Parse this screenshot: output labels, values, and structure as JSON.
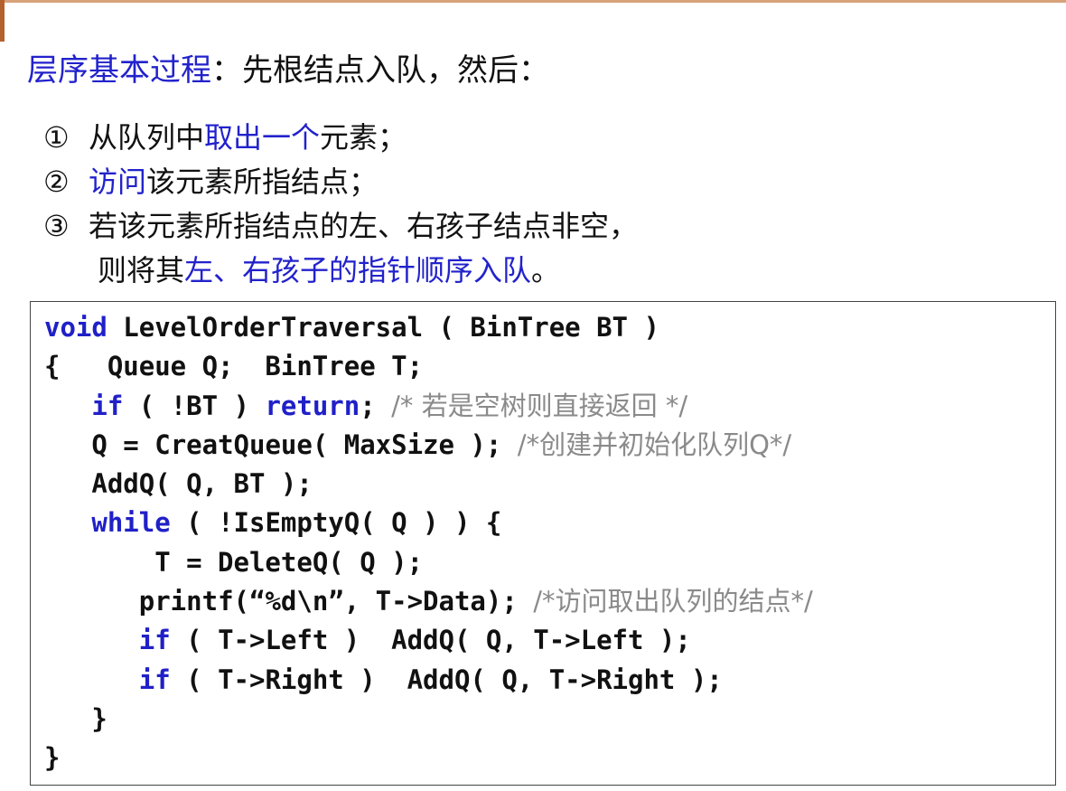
{
  "heading": {
    "highlight": "层序基本过程",
    "rest": "：先根结点入队，然后："
  },
  "steps": [
    {
      "num": "①",
      "pre": "从队列中",
      "hl": "取出一个",
      "post": "元素；"
    },
    {
      "num": "②",
      "pre": "",
      "hl": "访问",
      "post": "该元素所指结点；"
    },
    {
      "num": "③",
      "pre": "若该元素所指结点的左、右孩子结点非空，",
      "hl": "",
      "post": ""
    },
    {
      "num": "",
      "pre": "则将其",
      "hl": "左、右孩子的指针顺序入队",
      "post": "。"
    }
  ],
  "code": {
    "l1": {
      "kw": "void",
      "text": " LevelOrderTraversal ( BinTree BT )"
    },
    "l2": {
      "text": "{   Queue Q;  BinTree T;"
    },
    "l3": {
      "indent": "   ",
      "kw": "if",
      "mid": " ( !BT ) ",
      "kw2": "return",
      "text": "; ",
      "cm": "/* 若是空树则直接返回 */"
    },
    "l4": {
      "indent": "   ",
      "text": "Q = CreatQueue( MaxSize ); ",
      "cm": "/*创建并初始化队列Q*/"
    },
    "l5": {
      "indent": "   ",
      "text": "AddQ( Q, BT );"
    },
    "l6": {
      "indent": "   ",
      "kw": "while",
      "text": " ( !IsEmptyQ( Q ) ) {"
    },
    "l7": {
      "indent": "       ",
      "text": "T = DeleteQ( Q );"
    },
    "l8": {
      "indent": "      ",
      "text": "printf(“%d\\n”, T->Data); ",
      "cm": "/*访问取出队列的结点*/"
    },
    "l9": {
      "indent": "      ",
      "kw": "if",
      "text": " ( T->Left )  AddQ( Q, T->Left );"
    },
    "l10": {
      "indent": "      ",
      "kw": "if",
      "text": " ( T->Right )  AddQ( Q, T->Right );"
    },
    "l11": {
      "indent": "   ",
      "text": "}"
    },
    "l12": {
      "text": "}"
    }
  },
  "colors": {
    "highlight": "#2222cc",
    "keyword": "#2020c8",
    "comment": "#8a8a8a",
    "text": "#111111"
  }
}
